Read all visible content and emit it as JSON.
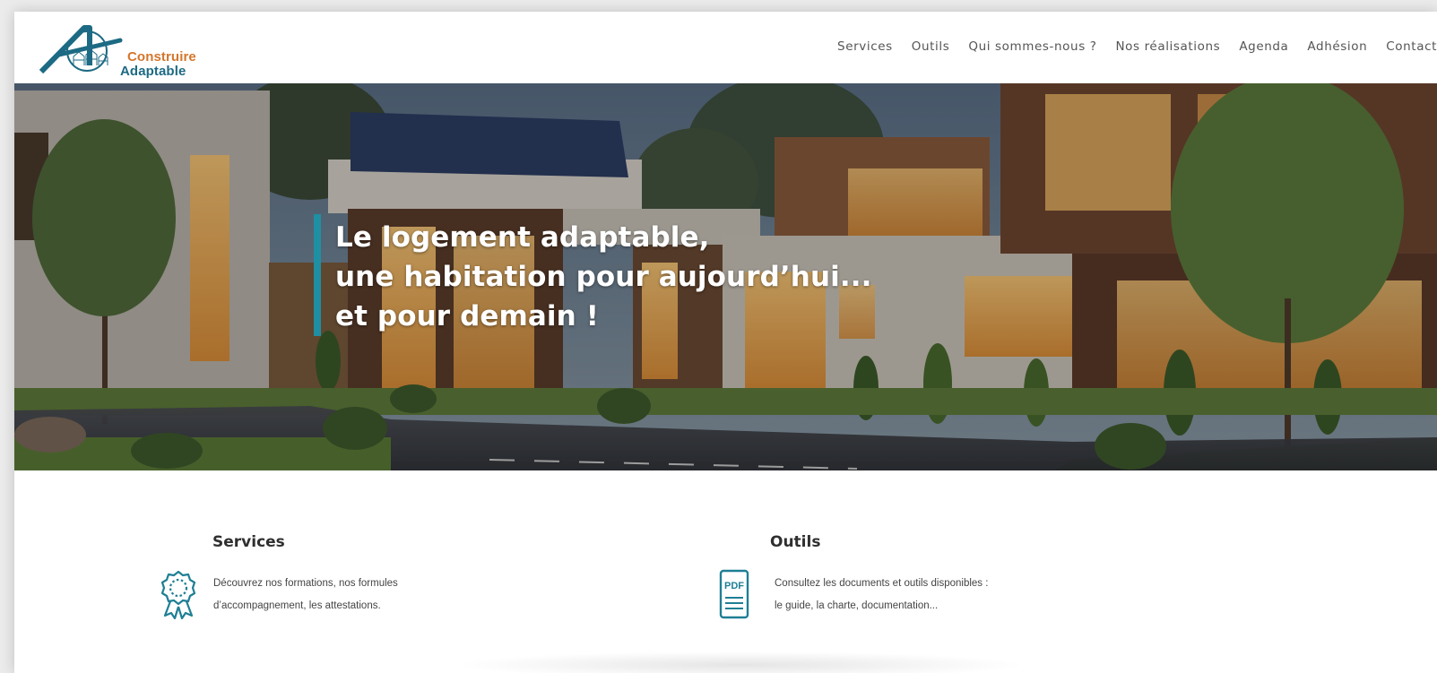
{
  "brand": {
    "line1": "Construire",
    "line2": "Adaptable",
    "color_primary": "#1d6a84",
    "color_accent": "#d4762c"
  },
  "nav": {
    "items": [
      "Services",
      "Outils",
      "Qui sommes-nous ?",
      "Nos réalisations",
      "Agenda",
      "Adhésion",
      "Contact"
    ]
  },
  "hero": {
    "line1": "Le logement adaptable,",
    "line2": "une habitation pour aujourd’hui...",
    "line3": "et pour demain !",
    "accent_color": "#1f8fa3"
  },
  "cards": [
    {
      "title": "Services",
      "line1": "Découvrez nos formations, nos formules",
      "line2": "d’accompagnement, les attestations.",
      "icon": "badge-icon"
    },
    {
      "title": "Outils",
      "line1": "Consultez les documents et outils disponibles :",
      "line2": "le guide, la charte, documentation...",
      "icon": "pdf-icon",
      "icon_label": "PDF"
    }
  ]
}
